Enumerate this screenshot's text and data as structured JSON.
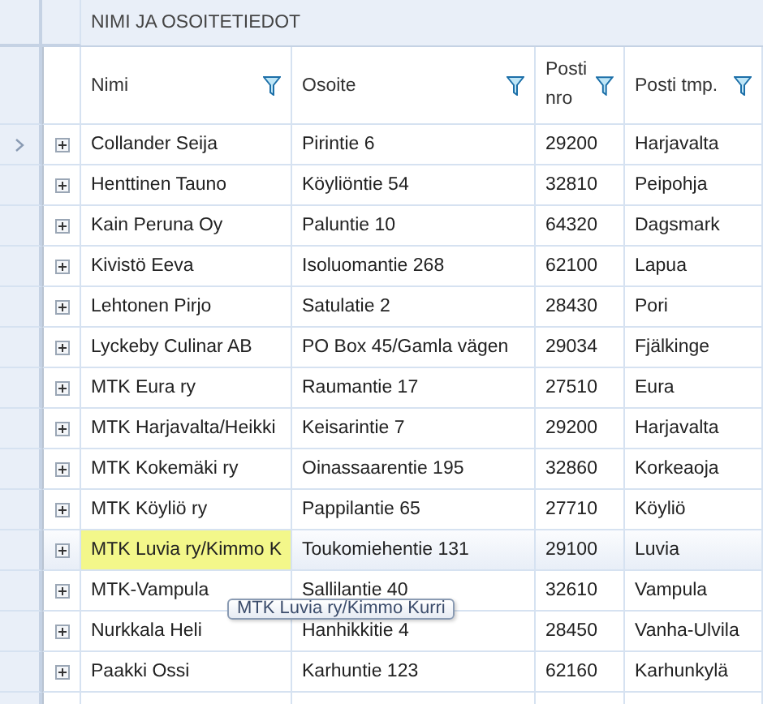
{
  "group_header": "NIMI JA OSOITETIEDOT",
  "columns": [
    {
      "label": "Nimi",
      "filter": true
    },
    {
      "label": "Osoite",
      "filter": true
    },
    {
      "label": "Posti nro",
      "filter": true
    },
    {
      "label": "Posti tmp.",
      "filter": true
    }
  ],
  "rows": [
    {
      "current": true,
      "hovered": false,
      "highlighted": false,
      "cells": [
        "Collander Seija",
        "Pirintie 6",
        "29200",
        "Harjavalta"
      ]
    },
    {
      "current": false,
      "hovered": false,
      "highlighted": false,
      "cells": [
        "Henttinen Tauno",
        "Köyliöntie 54",
        "32810",
        "Peipohja"
      ]
    },
    {
      "current": false,
      "hovered": false,
      "highlighted": false,
      "cells": [
        "Kain Peruna Oy",
        "Paluntie 10",
        "64320",
        "Dagsmark"
      ]
    },
    {
      "current": false,
      "hovered": false,
      "highlighted": false,
      "cells": [
        "Kivistö Eeva",
        "Isoluomantie 268",
        "62100",
        "Lapua"
      ]
    },
    {
      "current": false,
      "hovered": false,
      "highlighted": false,
      "cells": [
        "Lehtonen Pirjo",
        "Satulatie 2",
        "28430",
        "Pori"
      ]
    },
    {
      "current": false,
      "hovered": false,
      "highlighted": false,
      "cells": [
        "Lyckeby Culinar AB",
        "PO Box 45/Gamla vägen",
        "29034",
        "Fjälkinge"
      ]
    },
    {
      "current": false,
      "hovered": false,
      "highlighted": false,
      "cells": [
        "MTK Eura ry",
        "Raumantie 17",
        "27510",
        "Eura"
      ]
    },
    {
      "current": false,
      "hovered": false,
      "highlighted": false,
      "cells": [
        "MTK Harjavalta/Heikki",
        "Keisarintie 7",
        "29200",
        "Harjavalta"
      ]
    },
    {
      "current": false,
      "hovered": false,
      "highlighted": false,
      "cells": [
        "MTK Kokemäki ry",
        "Oinassaarentie 195",
        "32860",
        "Korkeaoja"
      ]
    },
    {
      "current": false,
      "hovered": false,
      "highlighted": false,
      "cells": [
        "MTK Köyliö ry",
        "Pappilantie 65",
        "27710",
        "Köyliö"
      ]
    },
    {
      "current": false,
      "hovered": true,
      "highlighted": true,
      "cells": [
        "MTK Luvia ry/Kimmo K",
        "Toukomiehentie 131",
        "29100",
        "Luvia"
      ]
    },
    {
      "current": false,
      "hovered": false,
      "highlighted": false,
      "cells": [
        "MTK-Vampula",
        "Sallilantie 40",
        "32610",
        "Vampula"
      ]
    },
    {
      "current": false,
      "hovered": false,
      "highlighted": false,
      "cells": [
        "Nurkkala Heli",
        "Hanhikkitie 4",
        "28450",
        "Vanha-Ulvila"
      ]
    },
    {
      "current": false,
      "hovered": false,
      "highlighted": false,
      "cells": [
        "Paakki Ossi",
        "Karhuntie 123",
        "62160",
        "Karhunkylä"
      ]
    }
  ],
  "tooltip": "MTK Luvia ry/Kimmo Kurri"
}
